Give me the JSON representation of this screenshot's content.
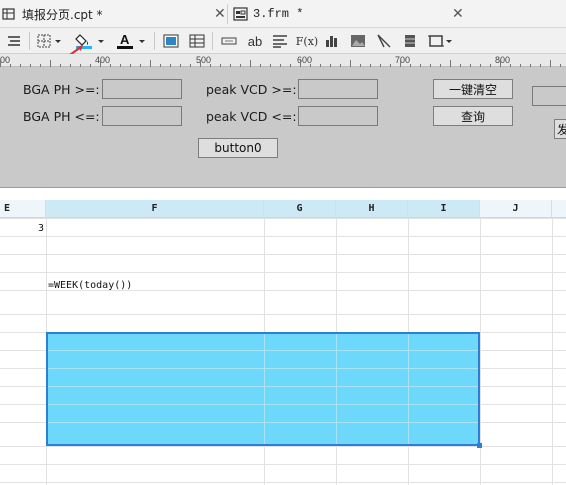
{
  "tabs": [
    {
      "label": "填报分页.cpt *",
      "icon": "table-file-icon"
    },
    {
      "label": "3.frm *",
      "icon": "form-file-icon"
    }
  ],
  "toolbar": {
    "items": [
      "align-icon",
      "border-icon",
      "fill-color-icon",
      "font-color-icon",
      "image-icon",
      "grid-icon",
      "cell-icon",
      "text-icon",
      "paragraph-icon",
      "formula-icon",
      "chart-icon",
      "picture-icon",
      "slash-icon",
      "column-icon",
      "frame-icon"
    ],
    "text_tool_label": "ab",
    "font_color_label": "A",
    "formula_label": "F(x)"
  },
  "ruler": {
    "marks": [
      "00",
      "400",
      "500",
      "600",
      "700",
      "800"
    ]
  },
  "form": {
    "bga_ge_label": "BGA PH >=:",
    "bga_le_label": "BGA PH <=:",
    "vcd_ge_label": "peak VCD >=:",
    "vcd_le_label": "peak VCD <=:",
    "clear_button": "一键清空",
    "query_button": "查询",
    "button0": "button0",
    "send_button_partial": "发"
  },
  "grid": {
    "columns": [
      "E",
      "F",
      "G",
      "H",
      "I",
      "J"
    ],
    "cells": {
      "E_first_value": "3",
      "F_formula": "=WEEK(today())"
    }
  },
  "colors": {
    "selection_fill": "#6ed8fb",
    "selection_border": "#2c7fd9",
    "header_fill": "#eef6fb",
    "form_bg": "#c9c9c9",
    "red_arrow": "#e03030"
  }
}
